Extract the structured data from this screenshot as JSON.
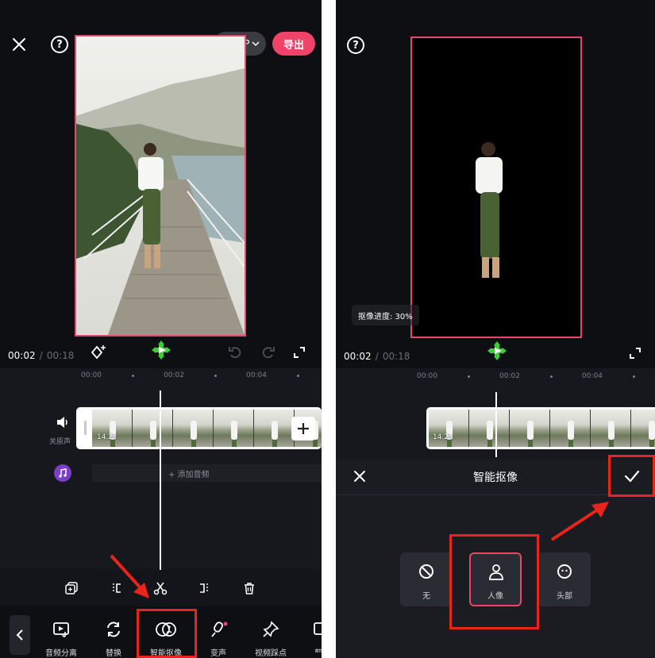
{
  "left": {
    "resolution": "1080P",
    "export_label": "导出",
    "time_current": "00:02",
    "time_separator": "/",
    "time_total": "00:18",
    "ruler_ticks": [
      "00:00",
      "00:02",
      "00:04"
    ],
    "clip_duration": "14.2s",
    "mute_label": "关原声",
    "add_audio_label": "+ 添加音频",
    "toolbar": [
      {
        "label": "音频分离",
        "icon": "audio-split-icon"
      },
      {
        "label": "替换",
        "icon": "replace-icon"
      },
      {
        "label": "智能抠像",
        "icon": "smart-cutout-icon"
      },
      {
        "label": "变声",
        "icon": "voice-change-icon"
      },
      {
        "label": "视频踩点",
        "icon": "beat-pin-icon"
      },
      {
        "label": "剪",
        "icon": "more-icon"
      }
    ]
  },
  "right": {
    "cutout_progress": "抠像进度: 30%",
    "time_current": "00:02",
    "time_separator": "/",
    "time_total": "00:18",
    "ruler_ticks": [
      "00:00",
      "00:02",
      "00:04"
    ],
    "clip_duration": "14.2s",
    "sheet_title": "智能抠像",
    "options": [
      {
        "label": "无",
        "icon": "none-icon"
      },
      {
        "label": "人像",
        "icon": "person-icon"
      },
      {
        "label": "头部",
        "icon": "head-icon"
      }
    ]
  },
  "colors": {
    "accent_pink": "#f0436a",
    "annotation_red": "#e8241c",
    "background": "#0e0f13"
  }
}
